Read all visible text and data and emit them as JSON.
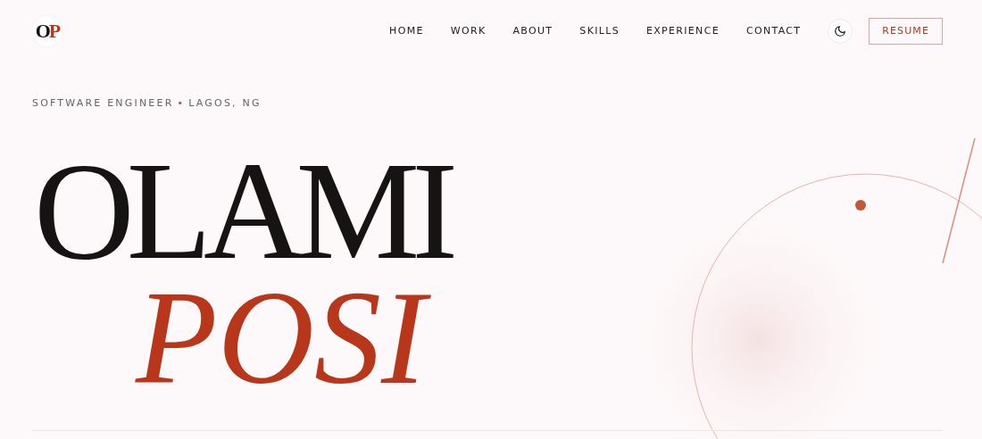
{
  "logo": "OP",
  "nav": {
    "links": [
      "HOME",
      "WORK",
      "ABOUT",
      "SKILLS",
      "EXPERIENCE",
      "CONTACT"
    ],
    "resume_button": "RESUME"
  },
  "hero": {
    "role": "SOFTWARE ENGINEER",
    "separator": "•",
    "location": "LAGOS, NG",
    "first_name": "OLAMI",
    "last_name": "POSI"
  }
}
